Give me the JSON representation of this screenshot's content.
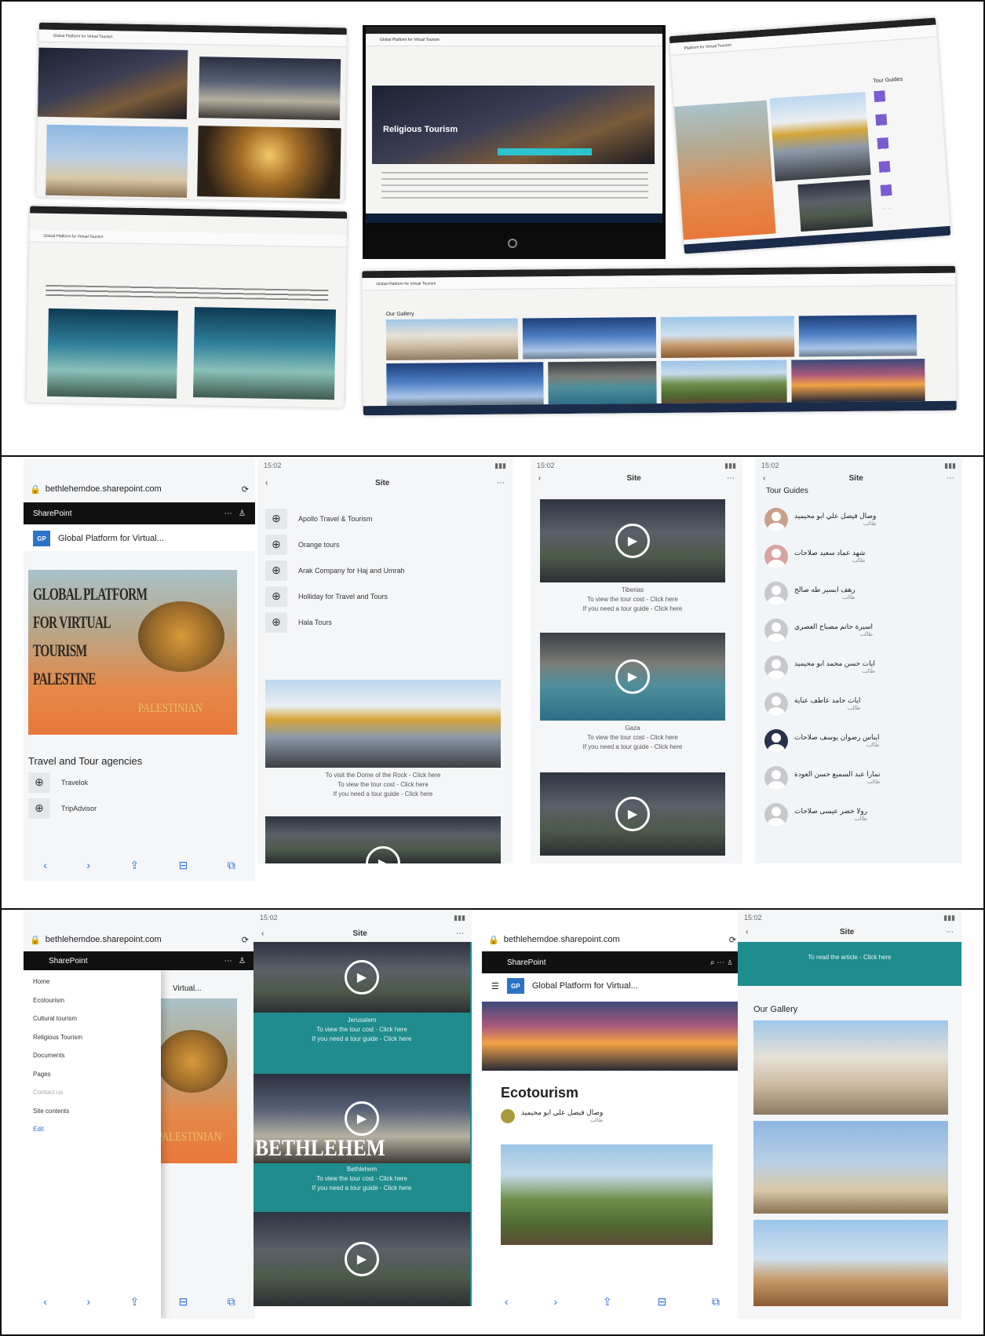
{
  "row1": {
    "s1": {
      "title": "Global Platform for Virtual Tourism",
      "app": "SharePoint"
    },
    "s2": {
      "title": "Global Platform for Virtual Tourism",
      "heading": "Religious Tourism"
    },
    "s3": {
      "title": "Platform for Virtual Tourism",
      "side": "Tour Guides"
    },
    "s4": {
      "title": "Global Platform for Virtual Tourism"
    },
    "s5": {
      "title": "Global Platform for Virtual Tourism",
      "heading": "Our Gallery"
    }
  },
  "row2": {
    "p1": {
      "url": "bethlehemdoe.sharepoint.com",
      "app": "SharePoint",
      "site_badge": "GP",
      "site_title": "Global Platform for Virtual...",
      "logo_lines": [
        "GLOBAL PLATFORM",
        "FOR VIRTUAL",
        "TOURISM",
        "PALESTINE"
      ],
      "logo_tag": "PALESTINIAN",
      "section": "Travel and Tour agencies",
      "agencies": [
        "Travelok",
        "TripAdvisor"
      ]
    },
    "p2": {
      "time": "15:02",
      "title": "Site",
      "agencies": [
        "Apollo Travel & Tourism",
        "Orange tours",
        "Arak Company for Haj and Umrah",
        "Holliday for Travel and Tours",
        "Hala Tours"
      ],
      "captions": [
        "To visit the Dome of the Rock - Click here",
        "To view the tour cost - Click here",
        "If you need a tour guide - Click here"
      ]
    },
    "p3": {
      "time": "15:02",
      "title": "Site",
      "videos": [
        {
          "name": "Tiberias",
          "cost": "To view the tour cost - Click here",
          "guide": "If you need a tour guide - Click here"
        },
        {
          "name": "Gaza",
          "cost": "To view the tour cost - Click here",
          "guide": "If you need a tour guide - Click here"
        }
      ]
    },
    "p4": {
      "time": "15:02",
      "title": "Site",
      "heading": "Tour Guides",
      "guides": [
        {
          "name": "وصال فيصل علي ابو محيميد",
          "role": "طالب"
        },
        {
          "name": "شهد عماد سعيد صلاحات",
          "role": "طالب"
        },
        {
          "name": "رهف ابسير طه صالح",
          "role": "طالب"
        },
        {
          "name": "اسيرة حاتم مصباح العصري",
          "role": "طالب"
        },
        {
          "name": "ايات حسن محمد ابو محيميد",
          "role": "طالب"
        },
        {
          "name": "ايات حامد عاطف عناية",
          "role": "طالب"
        },
        {
          "name": "ايناس رضوان يوسف صلاحات",
          "role": "طالب"
        },
        {
          "name": "تمارا عبد السميع حسن العودة",
          "role": "طالب"
        },
        {
          "name": "رولا خضر عيسى صلاحات",
          "role": "طالب"
        }
      ]
    }
  },
  "row3": {
    "p1": {
      "url": "bethlehemdoe.sharepoint.com",
      "app": "SharePoint",
      "menu": [
        "Home",
        "Ecotourism",
        "Cultural tourism",
        "Religious Tourism",
        "Documents",
        "Pages",
        "Contact us",
        "Site contents",
        "Edit"
      ],
      "logo_tag": "PALESTINIAN",
      "site_title": "Virtual..."
    },
    "p2": {
      "time": "15:02",
      "title": "Site",
      "videos": [
        {
          "name": "Jerusalem",
          "cost": "To view the tour cost - Click here",
          "guide": "If you need a tour guide - Click here"
        },
        {
          "name": "Bethlehem",
          "overlay": "BETHLEHEM",
          "cost": "To view the tour cost - Click here",
          "guide": "If you need a tour guide - Click here"
        }
      ]
    },
    "p3": {
      "url": "bethlehemdoe.sharepoint.com",
      "app": "SharePoint",
      "site_badge": "GP",
      "site_title": "Global Platform for Virtual...",
      "heading": "Ecotourism",
      "author": "وصال فيصل علي ابو محيميد",
      "author_role": "طالب"
    },
    "p4": {
      "time": "15:02",
      "title": "Site",
      "article": "To read the article - Click here",
      "heading": "Our Gallery"
    }
  }
}
